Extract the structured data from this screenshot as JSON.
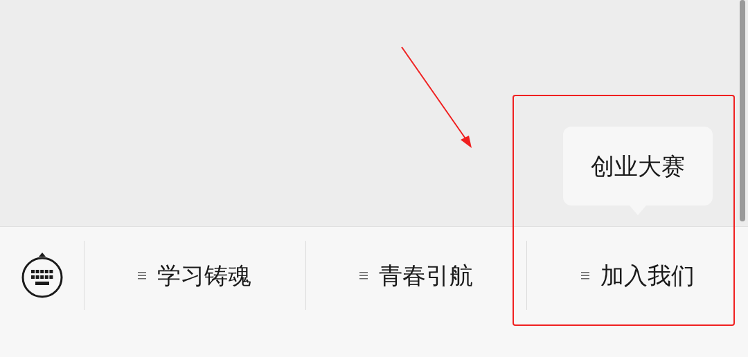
{
  "menu": {
    "items": [
      {
        "label": "学习铸魂"
      },
      {
        "label": "青春引航"
      },
      {
        "label": "加入我们",
        "submenu": [
          "创业大赛"
        ]
      }
    ]
  }
}
